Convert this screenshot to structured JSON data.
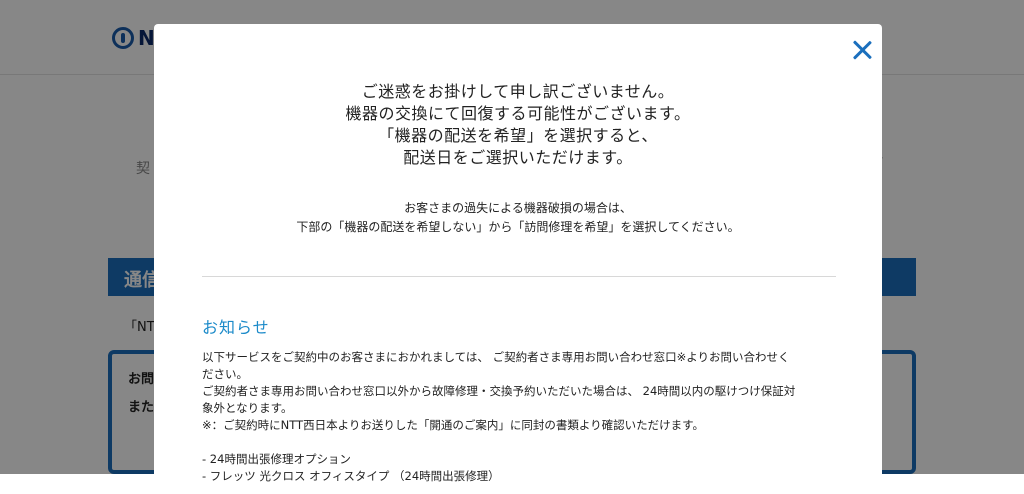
{
  "background": {
    "logo_text": "N",
    "steps_text": "契",
    "steps_right": "›",
    "section_title": "通信",
    "note_text": "「NTT",
    "box_line1": "お問",
    "box_line2": "また"
  },
  "modal": {
    "close_label": "×",
    "lead_lines": [
      "ご迷惑をお掛けして申し訳ございません。",
      "機器の交換にて回復する可能性がございます。",
      "「機器の配送を希望」を選択すると、",
      "配送日をご選択いただけます。"
    ],
    "sub_lines": [
      "お客さまの過失による機器破損の場合は、",
      "下部の「機器の配送を希望しない」から「訪問修理を希望」を選択してください。"
    ],
    "notice": {
      "title": "お知らせ",
      "lines": [
        "以下サービスをご契約中のお客さまにおかれましては、 ご契約者さま専用お問い合わせ窓口※よりお問い合わせく",
        "ださい。",
        "ご契約者さま専用お問い合わせ窓口以外から故障修理・交換予約いただいた場合は、 24時間以内の駆けつけ保証対",
        "象外となります。",
        "※：ご契約時にNTT西日本よりお送りした「開通のご案内」に同封の書類より確認いただけます。",
        "",
        "- 24時間出張修理オプション",
        "- フレッツ 光クロス オフィスタイプ （24時間出張修理）"
      ]
    }
  }
}
